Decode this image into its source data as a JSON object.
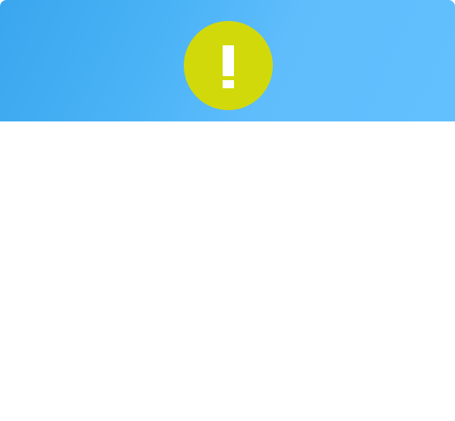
{
  "dialog": {
    "header": {
      "gradient_start": "#3aa6ee",
      "gradient_end": "#62c0ff",
      "icon": {
        "name": "exclamation-icon",
        "glyph": "!",
        "circle_color": "#d1d90b",
        "glyph_color": "#ffffff"
      }
    },
    "body": {}
  }
}
